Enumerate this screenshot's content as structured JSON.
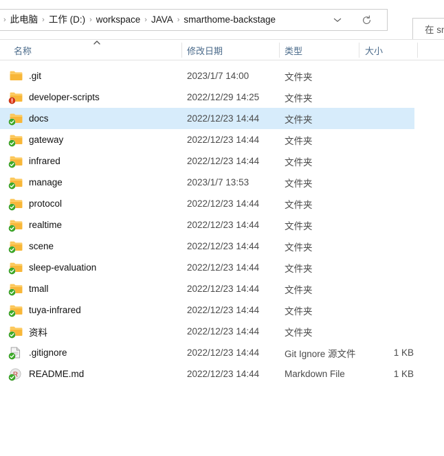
{
  "window": {
    "app": "Windows File Explorer",
    "accent_selection_color": "#d7ecfb",
    "header_text_color": "#4a6a8a"
  },
  "address_bar": {
    "crumbs": [
      {
        "label": "此电脑"
      },
      {
        "label": "工作 (D:)"
      },
      {
        "label": "workspace"
      },
      {
        "label": "JAVA"
      },
      {
        "label": "smarthome-backstage"
      }
    ],
    "separator": "›",
    "dropdown_icon": "chevron-down-icon",
    "refresh_icon": "refresh-icon"
  },
  "search": {
    "icon": "search-icon",
    "placeholder": "在 smarthome-backstage 中搜索",
    "visible_text": "在"
  },
  "columns": {
    "name": "名称",
    "date_modified": "修改日期",
    "type": "类型",
    "size": "大小",
    "sort_column": "名称",
    "sort_direction": "ascending",
    "sort_icon": "sort-ascending-caret-icon"
  },
  "files": [
    {
      "name": ".git",
      "date": "2023/1/7 14:00",
      "type": "文件夹",
      "size": "",
      "icon": "folder-icon",
      "badge": "none"
    },
    {
      "name": "developer-scripts",
      "date": "2022/12/29 14:25",
      "type": "文件夹",
      "size": "",
      "icon": "folder-icon",
      "badge": "git-modified-red-badge"
    },
    {
      "name": "docs",
      "date": "2022/12/23 14:44",
      "type": "文件夹",
      "size": "",
      "icon": "folder-icon",
      "badge": "git-normal-green-badge",
      "selected": true
    },
    {
      "name": "gateway",
      "date": "2022/12/23 14:44",
      "type": "文件夹",
      "size": "",
      "icon": "folder-icon",
      "badge": "git-normal-green-badge"
    },
    {
      "name": "infrared",
      "date": "2022/12/23 14:44",
      "type": "文件夹",
      "size": "",
      "icon": "folder-icon",
      "badge": "git-normal-green-badge"
    },
    {
      "name": "manage",
      "date": "2023/1/7 13:53",
      "type": "文件夹",
      "size": "",
      "icon": "folder-icon",
      "badge": "git-normal-green-badge"
    },
    {
      "name": "protocol",
      "date": "2022/12/23 14:44",
      "type": "文件夹",
      "size": "",
      "icon": "folder-icon",
      "badge": "git-normal-green-badge"
    },
    {
      "name": "realtime",
      "date": "2022/12/23 14:44",
      "type": "文件夹",
      "size": "",
      "icon": "folder-icon",
      "badge": "git-normal-green-badge"
    },
    {
      "name": "scene",
      "date": "2022/12/23 14:44",
      "type": "文件夹",
      "size": "",
      "icon": "folder-icon",
      "badge": "git-normal-green-badge"
    },
    {
      "name": "sleep-evaluation",
      "date": "2022/12/23 14:44",
      "type": "文件夹",
      "size": "",
      "icon": "folder-icon",
      "badge": "git-normal-green-badge"
    },
    {
      "name": "tmall",
      "date": "2022/12/23 14:44",
      "type": "文件夹",
      "size": "",
      "icon": "folder-icon",
      "badge": "git-normal-green-badge"
    },
    {
      "name": "tuya-infrared",
      "date": "2022/12/23 14:44",
      "type": "文件夹",
      "size": "",
      "icon": "folder-icon",
      "badge": "git-normal-green-badge"
    },
    {
      "name": "资料",
      "date": "2022/12/23 14:44",
      "type": "文件夹",
      "size": "",
      "icon": "folder-icon",
      "badge": "git-normal-green-badge"
    },
    {
      "name": ".gitignore",
      "date": "2022/12/23 14:44",
      "type": "Git Ignore 源文件",
      "size": "1 KB",
      "icon": "document-icon",
      "badge": "git-normal-green-badge"
    },
    {
      "name": "README.md",
      "date": "2022/12/23 14:44",
      "type": "Markdown File",
      "size": "1 KB",
      "icon": "markdown-file-icon",
      "badge": "git-normal-green-badge"
    }
  ]
}
